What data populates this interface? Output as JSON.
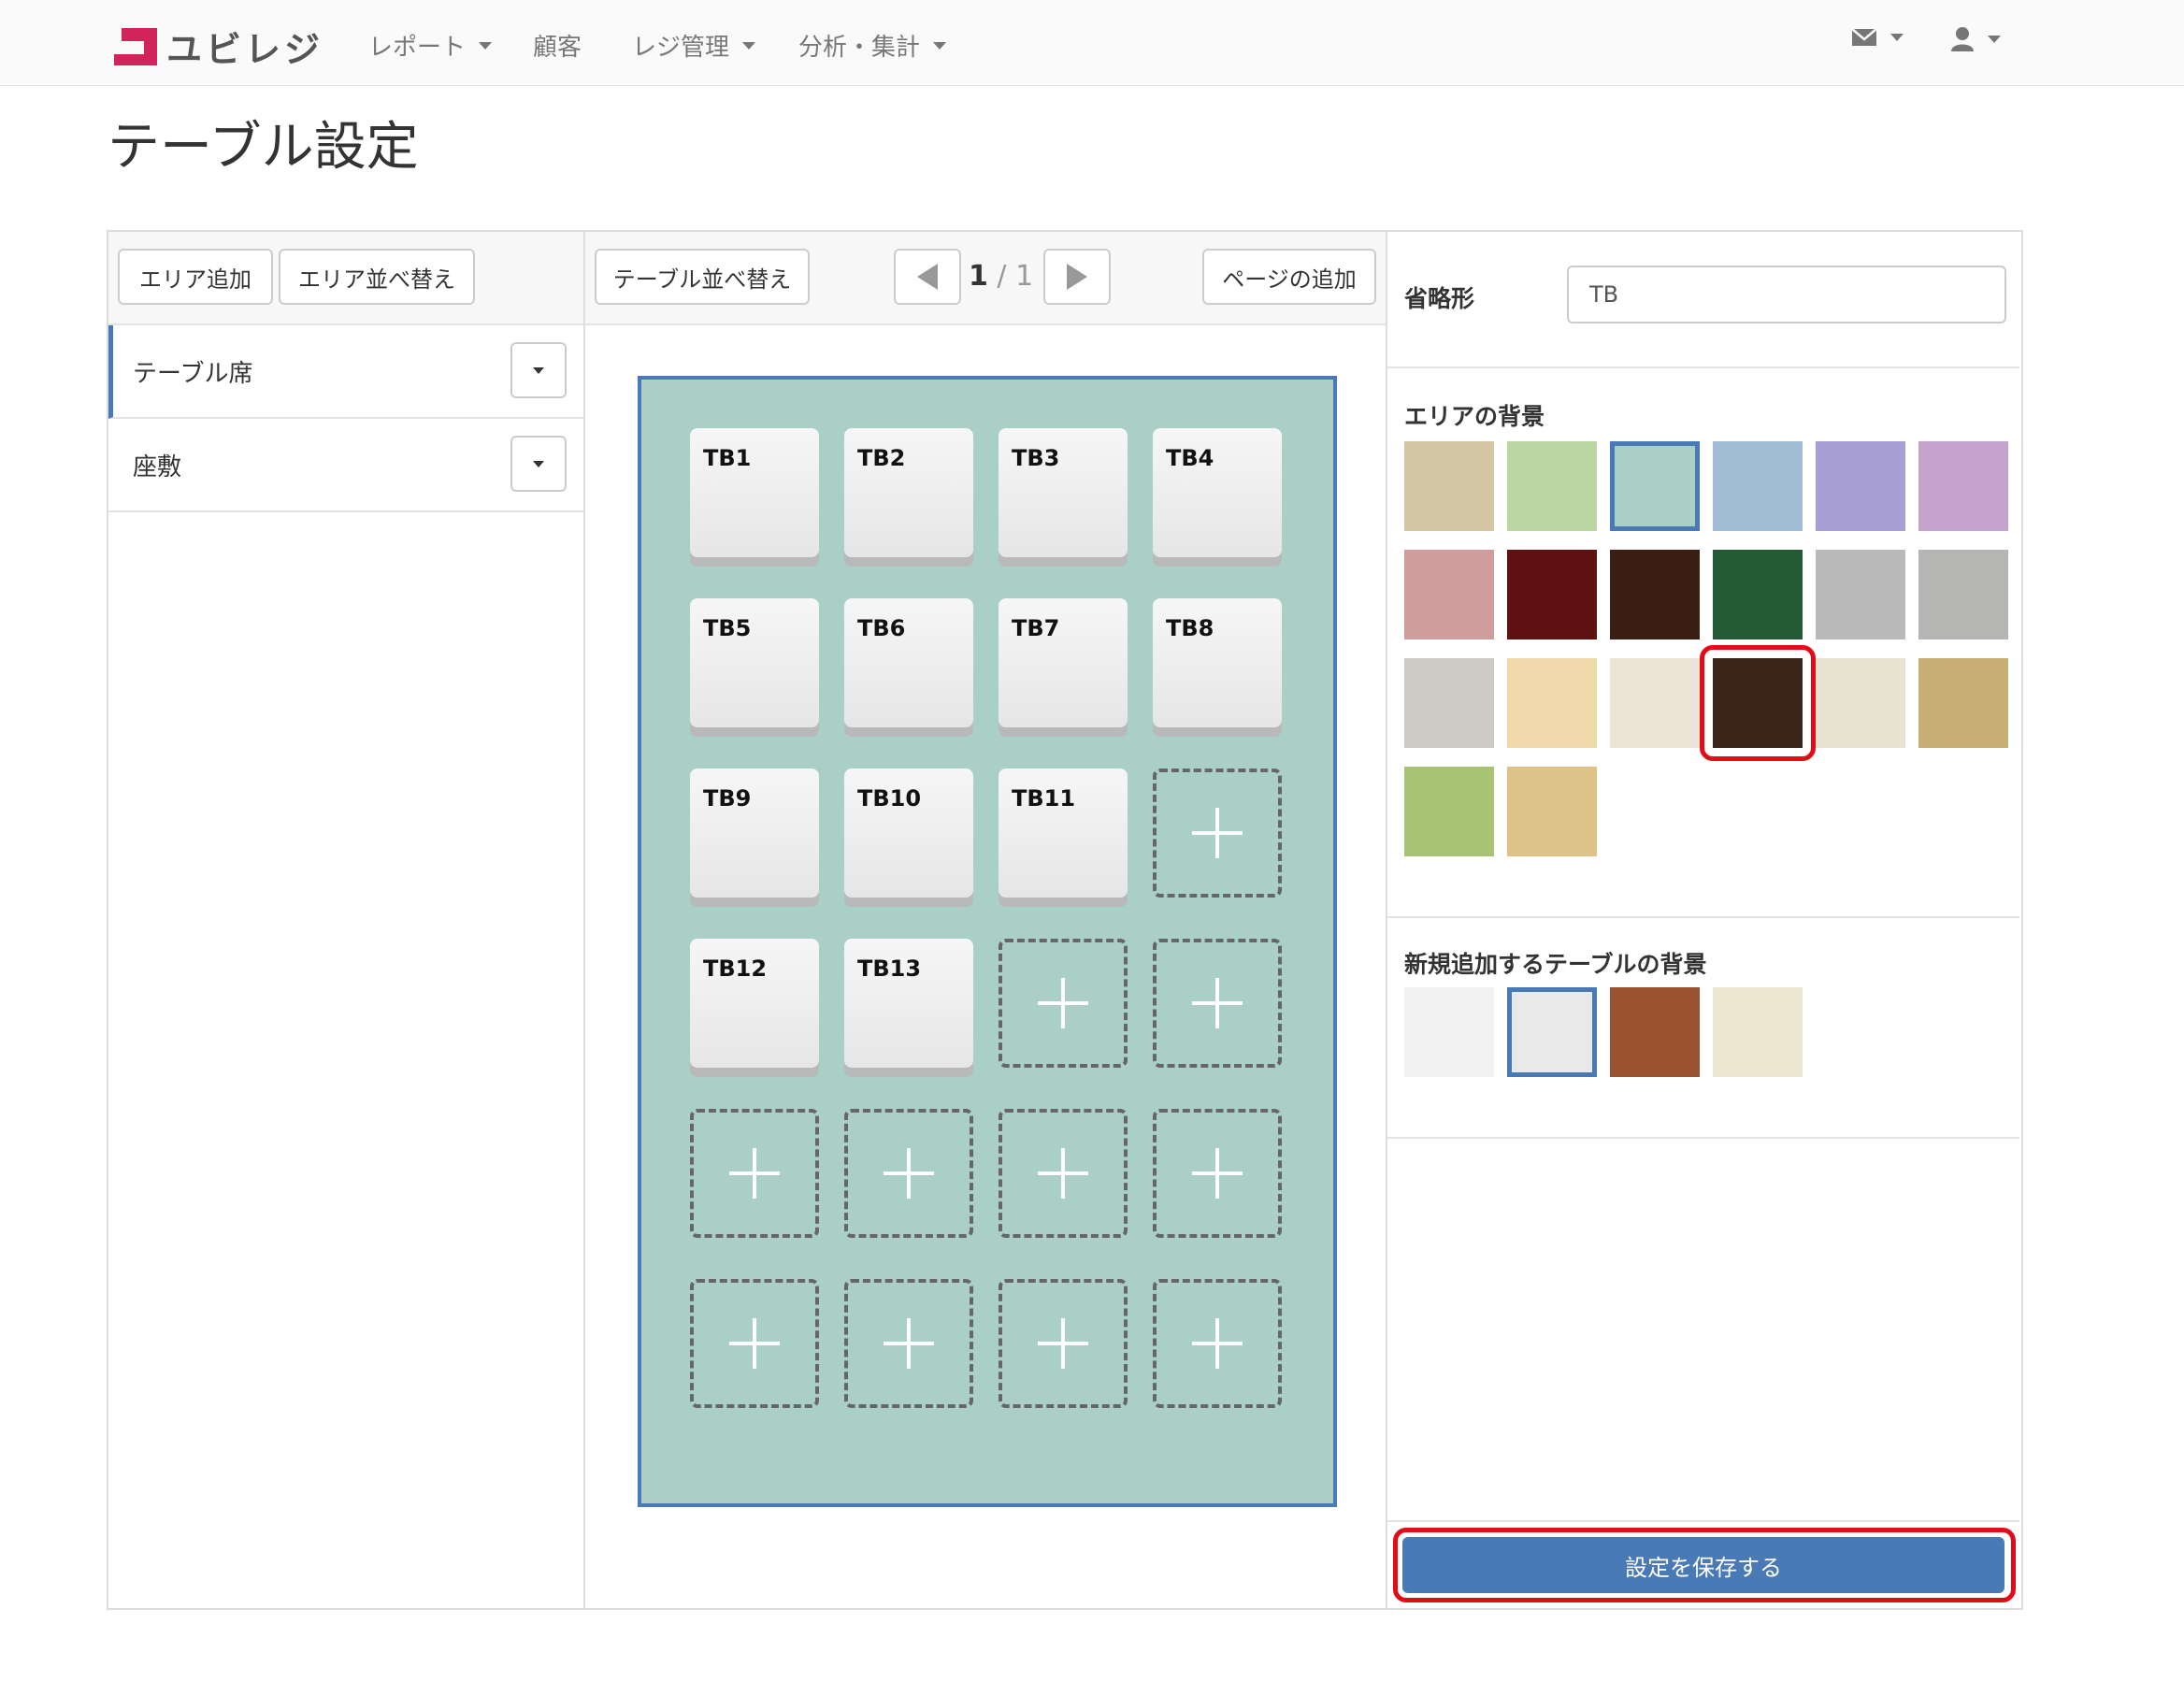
{
  "app": {
    "logo_text": "ユビレジ"
  },
  "nav": {
    "items": [
      {
        "label": "レポート",
        "dropdown": true
      },
      {
        "label": "顧客",
        "dropdown": false
      },
      {
        "label": "レジ管理",
        "dropdown": true
      },
      {
        "label": "分析・集計",
        "dropdown": true
      }
    ],
    "mail_icon": "mail-icon",
    "user_icon": "user-icon"
  },
  "page": {
    "title": "テーブル設定"
  },
  "left": {
    "add_area": "エリア追加",
    "sort_area": "エリア並べ替え",
    "areas": [
      {
        "label": "テーブル席",
        "active": true
      },
      {
        "label": "座敷",
        "active": false
      }
    ]
  },
  "middle": {
    "sort_tables": "テーブル並べ替え",
    "page_current": "1",
    "page_sep": " / ",
    "page_total": "1",
    "add_page": "ページの追加",
    "tables": [
      "TB1",
      "TB2",
      "TB3",
      "TB4",
      "TB5",
      "TB6",
      "TB7",
      "TB8",
      "TB9",
      "TB10",
      "TB11",
      "",
      "TB12",
      "TB13",
      "",
      "",
      "",
      "",
      "",
      "",
      "",
      "",
      "",
      ""
    ]
  },
  "right": {
    "abbrev_label": "省略形",
    "abbrev_value": "TB",
    "area_bg_label": "エリアの背景",
    "area_bg_swatches": [
      "#d3c7a3",
      "#bcd6a3",
      "#a9cfc6",
      "#a2bdd4",
      "#a79ed4",
      "#c6a3cd",
      "#cf9d9e",
      "#5e1211",
      "#3a1e12",
      "#245a33",
      "#b9b9b9",
      "#b5b5b3",
      "#cccac4",
      "#f0d9ab",
      "#ece3d7",
      "#3b2418",
      "#e6e3cf",
      "#c6ae74",
      "#a8c374",
      "#ddc387"
    ],
    "area_bg_selected": 2,
    "area_bg_highlighted": 15,
    "table_bg_label": "新規追加するテーブルの背景",
    "table_bg_swatches": [
      "#f2f2f2",
      "#e9e9e9",
      "#9b5431",
      "#ede6d0"
    ],
    "table_bg_selected": 1,
    "save": "設定を保存する"
  }
}
